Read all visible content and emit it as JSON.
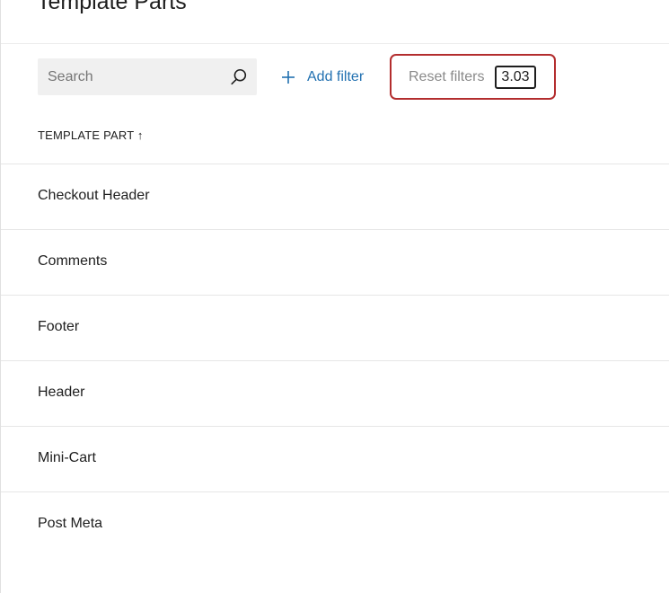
{
  "page": {
    "title": "Template Parts"
  },
  "toolbar": {
    "search_placeholder": "Search",
    "search_value": "",
    "add_filter_label": "Add filter",
    "reset_filters_label": "Reset filters",
    "version_badge": "3.03"
  },
  "table": {
    "column_header": "TEMPLATE PART ↑",
    "rows": [
      {
        "label": "Checkout Header"
      },
      {
        "label": "Comments"
      },
      {
        "label": "Footer"
      },
      {
        "label": "Header"
      },
      {
        "label": "Mini-Cart"
      },
      {
        "label": "Post Meta"
      }
    ]
  },
  "colors": {
    "accent": "#2271b1",
    "highlight_border": "#b32d2e",
    "search_background": "#f0f0f0",
    "muted_text": "#8a8a8a"
  },
  "icons": {
    "search": "search-icon",
    "add": "plus-icon"
  }
}
